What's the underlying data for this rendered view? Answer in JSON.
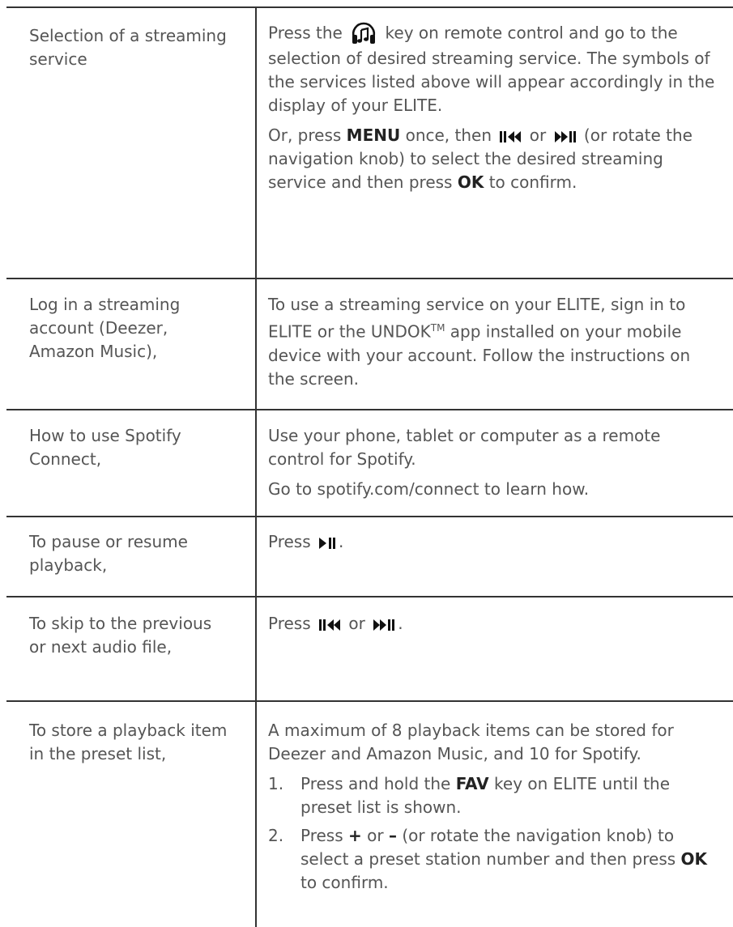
{
  "rows": [
    {
      "action": "Selection of a streaming service",
      "p1_before": "Press the",
      "p1_after": "key on remote control and go to the selection of desired streaming service. The symbols of the services listed above will appear accordingly in the display of your ELITE.",
      "p2_a": "Or, press",
      "p2_menu": "MENU",
      "p2_b": "once, then",
      "p2_or": "or",
      "p2_c": "(or rotate the navigation knob) to select the desired streaming service and then press",
      "p2_ok": "OK",
      "p2_d": "to confirm."
    },
    {
      "action": "Log in a streaming account (Deezer, Amazon Music),",
      "text_a": "To use a streaming service on your ELITE, sign in to ELITE or the UNDOK",
      "text_tm": "TM",
      "text_b": "app installed on your mobile device with your account. Follow the instructions on the screen."
    },
    {
      "action": "How to use Spotify Connect,",
      "line1": "Use your phone, tablet or computer as a remote control for Spotify.",
      "line2": "Go to spotify.com/connect to learn how."
    },
    {
      "action": "To pause or resume playback,",
      "text_a": "Press",
      "text_b": "."
    },
    {
      "action": "To skip to the previous or next audio file,",
      "text_a": "Press",
      "text_or": "or",
      "text_b": "."
    },
    {
      "action": "To store a playback item in the preset list,",
      "intro": "A maximum of 8 playback items can be stored for Deezer and Amazon Music, and 10 for Spotify.",
      "step1_num": "1.",
      "step1_a": "Press and hold the",
      "step1_key": "FAV",
      "step1_b": "key on ELITE until the preset list is shown.",
      "step2_num": "2.",
      "step2_a": "Press",
      "step2_plus": "+",
      "step2_or": "or",
      "step2_minus": "–",
      "step2_b": "(or rotate the navigation knob) to select a preset station number and then press",
      "step2_ok": "OK",
      "step2_c": "to confirm."
    }
  ],
  "icons": {
    "streaming": "streaming-service-icon",
    "prev": "previous-track-icon",
    "next": "next-track-icon",
    "play_pause": "play-pause-icon"
  }
}
